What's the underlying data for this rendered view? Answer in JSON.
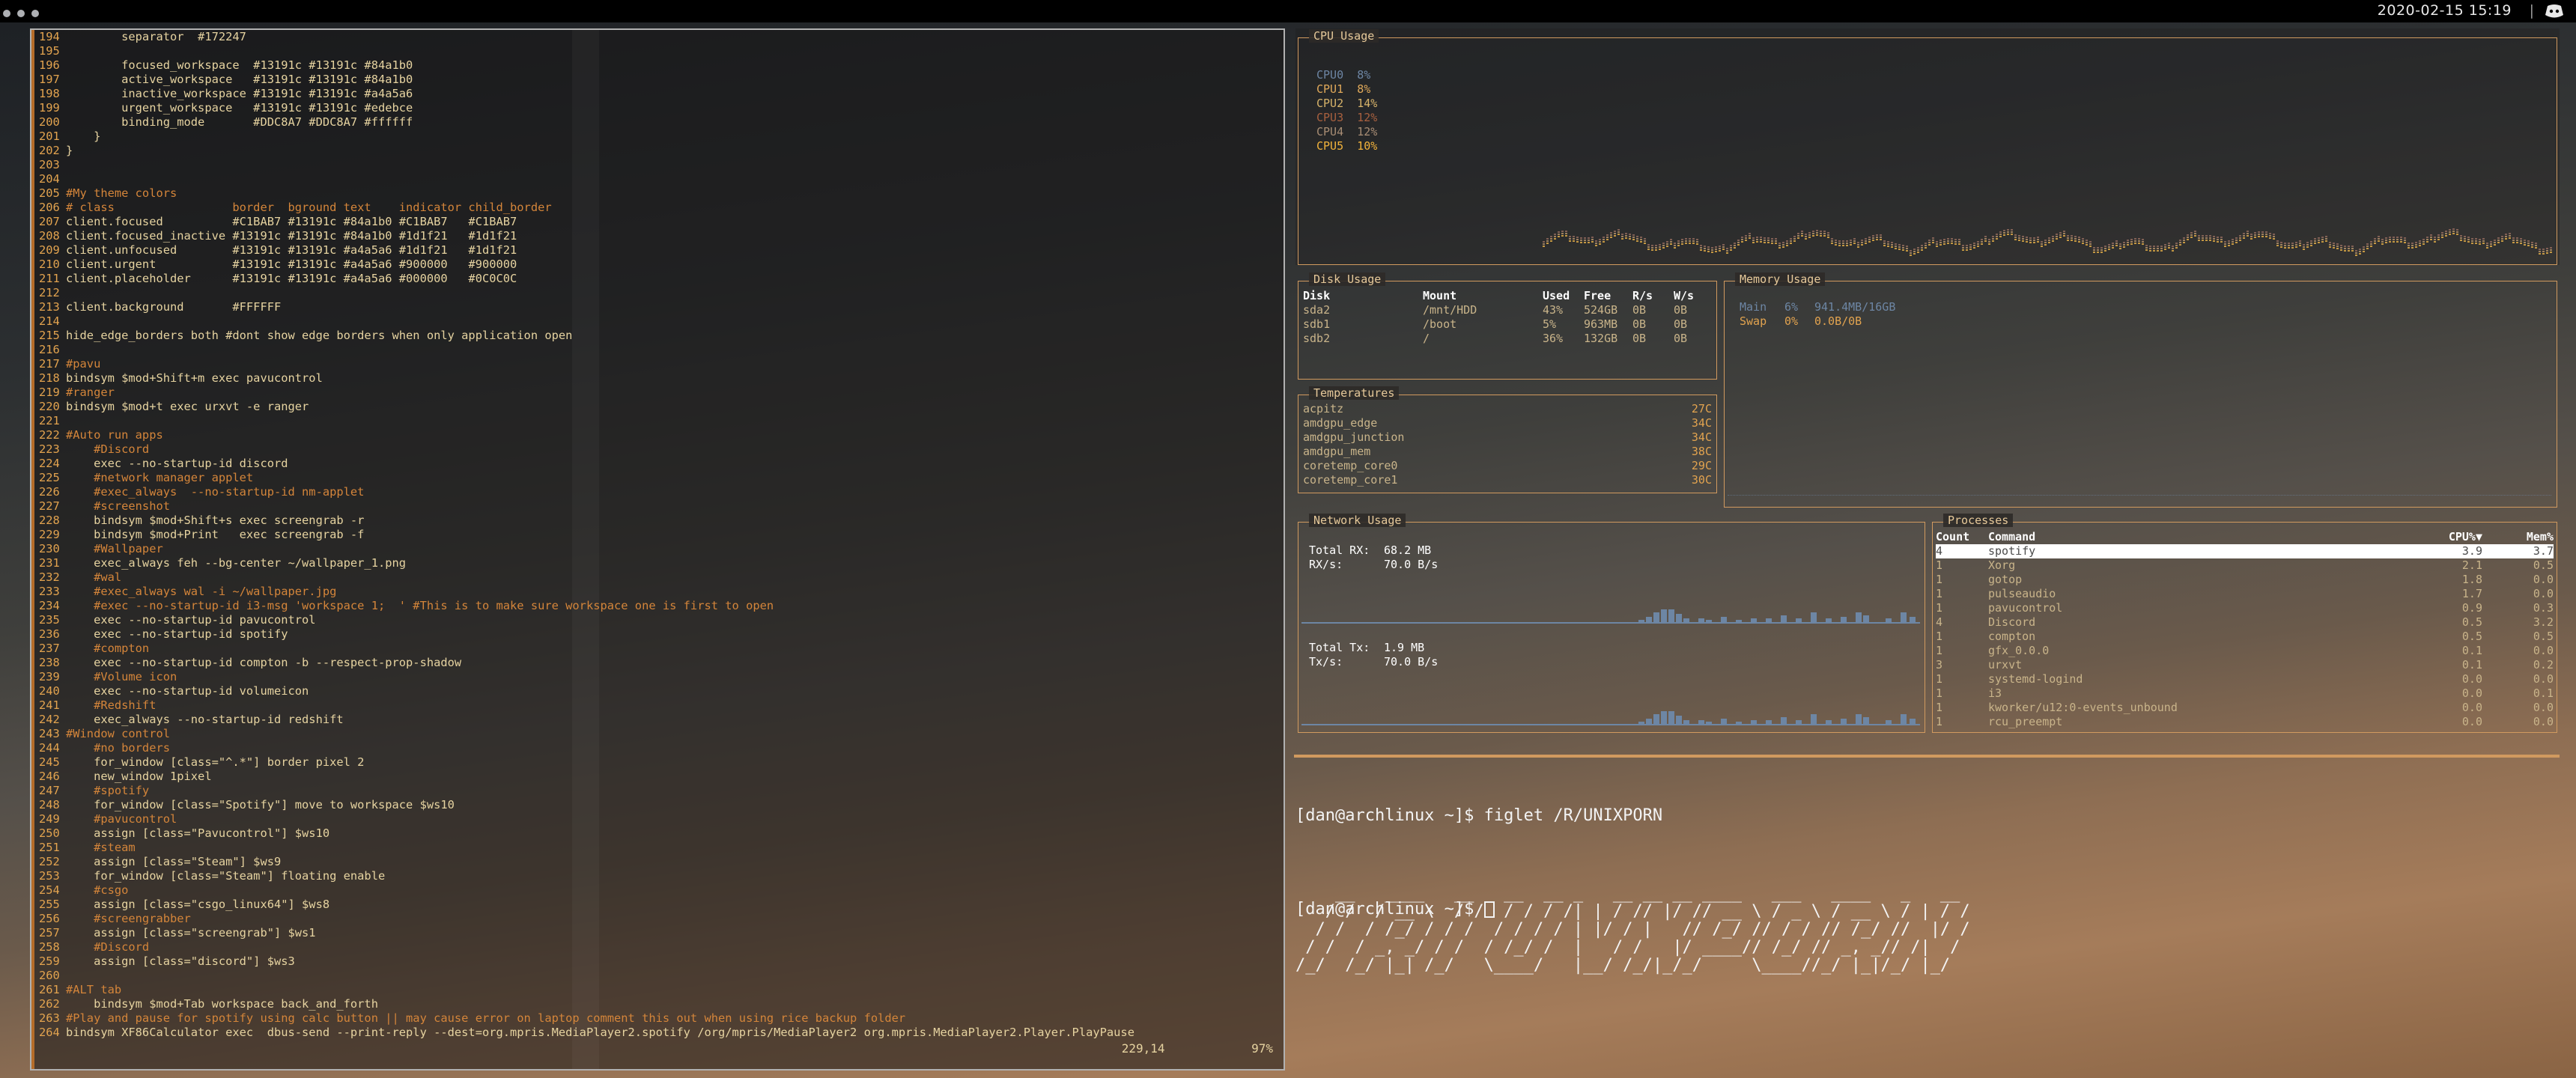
{
  "topbar": {
    "clock": "2020-02-15 15:19"
  },
  "editor": {
    "status_pos": "229,14",
    "status_pct": "97%",
    "lines": [
      {
        "n": "194",
        "text": "        separator  #172247",
        "kind": "t"
      },
      {
        "n": "195",
        "text": "",
        "kind": "t"
      },
      {
        "n": "196",
        "text": "        focused_workspace  #13191c #13191c #84a1b0",
        "kind": "t"
      },
      {
        "n": "197",
        "text": "        active_workspace   #13191c #13191c #84a1b0",
        "kind": "t"
      },
      {
        "n": "198",
        "text": "        inactive_workspace #13191c #13191c #a4a5a6",
        "kind": "t"
      },
      {
        "n": "199",
        "text": "        urgent_workspace   #13191c #13191c #edebce",
        "kind": "t"
      },
      {
        "n": "200",
        "text": "        binding_mode       #DDC8A7 #DDC8A7 #ffffff",
        "kind": "t"
      },
      {
        "n": "201",
        "text": "    }",
        "kind": "t"
      },
      {
        "n": "202",
        "text": "}",
        "kind": "t"
      },
      {
        "n": "203",
        "text": "",
        "kind": "t"
      },
      {
        "n": "204",
        "text": "",
        "kind": "t"
      },
      {
        "n": "205",
        "text": "#My theme colors",
        "kind": "c"
      },
      {
        "n": "206",
        "text": "# class                 border  bground text    indicator child_border",
        "kind": "c"
      },
      {
        "n": "207",
        "text": "client.focused          #C1BAB7 #13191c #84a1b0 #C1BAB7   #C1BAB7",
        "kind": "t"
      },
      {
        "n": "208",
        "text": "client.focused_inactive #13191c #13191c #84a1b0 #1d1f21   #1d1f21",
        "kind": "t"
      },
      {
        "n": "209",
        "text": "client.unfocused        #13191c #13191c #a4a5a6 #1d1f21   #1d1f21",
        "kind": "t"
      },
      {
        "n": "210",
        "text": "client.urgent           #13191c #13191c #a4a5a6 #900000   #900000",
        "kind": "t"
      },
      {
        "n": "211",
        "text": "client.placeholder      #13191c #13191c #a4a5a6 #000000   #0C0C0C",
        "kind": "t"
      },
      {
        "n": "212",
        "text": "",
        "kind": "t"
      },
      {
        "n": "213",
        "text": "client.background       #FFFFFF",
        "kind": "t"
      },
      {
        "n": "214",
        "text": "",
        "kind": "t"
      },
      {
        "n": "215",
        "text": "hide_edge_borders both #dont show edge borders when only application open",
        "kind": "t"
      },
      {
        "n": "216",
        "text": "",
        "kind": "t"
      },
      {
        "n": "217",
        "text": "#pavu",
        "kind": "c"
      },
      {
        "n": "218",
        "text": "bindsym $mod+Shift+m exec pavucontrol",
        "kind": "t"
      },
      {
        "n": "219",
        "text": "#ranger",
        "kind": "c"
      },
      {
        "n": "220",
        "text": "bindsym $mod+t exec urxvt -e ranger",
        "kind": "t"
      },
      {
        "n": "221",
        "text": "",
        "kind": "t"
      },
      {
        "n": "222",
        "text": "#Auto run apps",
        "kind": "c"
      },
      {
        "n": "223",
        "text": "    #Discord",
        "kind": "c"
      },
      {
        "n": "224",
        "text": "    exec --no-startup-id discord",
        "kind": "t"
      },
      {
        "n": "225",
        "text": "    #network manager applet",
        "kind": "c"
      },
      {
        "n": "226",
        "text": "    #exec_always  --no-startup-id nm-applet",
        "kind": "c"
      },
      {
        "n": "227",
        "text": "    #screenshot",
        "kind": "c"
      },
      {
        "n": "228",
        "text": "    bindsym $mod+Shift+s exec screengrab -r",
        "kind": "t"
      },
      {
        "n": "229",
        "text": "    bindsym $mod+Print   exec screengrab -f",
        "kind": "t"
      },
      {
        "n": "230",
        "text": "    #Wallpaper",
        "kind": "c"
      },
      {
        "n": "231",
        "text": "    exec_always feh --bg-center ~/wallpaper_1.png",
        "kind": "t"
      },
      {
        "n": "232",
        "text": "    #wal",
        "kind": "c"
      },
      {
        "n": "233",
        "text": "    #exec_always wal -i ~/wallpaper.jpg",
        "kind": "c"
      },
      {
        "n": "234",
        "text": "    #exec --no-startup-id i3-msg 'workspace 1;  ' #This is to make sure workspace one is first to open",
        "kind": "c"
      },
      {
        "n": "235",
        "text": "    exec --no-startup-id pavucontrol",
        "kind": "t"
      },
      {
        "n": "236",
        "text": "    exec --no-startup-id spotify",
        "kind": "t"
      },
      {
        "n": "237",
        "text": "    #compton",
        "kind": "c"
      },
      {
        "n": "238",
        "text": "    exec --no-startup-id compton -b --respect-prop-shadow",
        "kind": "t"
      },
      {
        "n": "239",
        "text": "    #Volume icon",
        "kind": "c"
      },
      {
        "n": "240",
        "text": "    exec --no-startup-id volumeicon",
        "kind": "t"
      },
      {
        "n": "241",
        "text": "    #Redshift",
        "kind": "c"
      },
      {
        "n": "242",
        "text": "    exec_always --no-startup-id redshift",
        "kind": "t"
      },
      {
        "n": "243",
        "text": "#Window control",
        "kind": "c"
      },
      {
        "n": "244",
        "text": "    #no borders",
        "kind": "c"
      },
      {
        "n": "245",
        "text": "    for_window [class=\"^.*\"] border pixel 2",
        "kind": "t"
      },
      {
        "n": "246",
        "text": "    new_window 1pixel",
        "kind": "t"
      },
      {
        "n": "247",
        "text": "    #spotify",
        "kind": "c"
      },
      {
        "n": "248",
        "text": "    for_window [class=\"Spotify\"] move to workspace $ws10",
        "kind": "t"
      },
      {
        "n": "249",
        "text": "    #pavucontrol",
        "kind": "c"
      },
      {
        "n": "250",
        "text": "    assign [class=\"Pavucontrol\"] $ws10",
        "kind": "t"
      },
      {
        "n": "251",
        "text": "    #steam",
        "kind": "c"
      },
      {
        "n": "252",
        "text": "    assign [class=\"Steam\"] $ws9",
        "kind": "t"
      },
      {
        "n": "253",
        "text": "    for_window [class=\"Steam\"] floating enable",
        "kind": "t"
      },
      {
        "n": "254",
        "text": "    #csgo",
        "kind": "c"
      },
      {
        "n": "255",
        "text": "    assign [class=\"csgo_linux64\"] $ws8",
        "kind": "t"
      },
      {
        "n": "256",
        "text": "    #screengrabber",
        "kind": "c"
      },
      {
        "n": "257",
        "text": "    assign [class=\"screengrab\"] $ws1",
        "kind": "t"
      },
      {
        "n": "258",
        "text": "    #Discord",
        "kind": "c"
      },
      {
        "n": "259",
        "text": "    assign [class=\"discord\"] $ws3",
        "kind": "t"
      },
      {
        "n": "260",
        "text": "",
        "kind": "t"
      },
      {
        "n": "261",
        "text": "#ALT tab",
        "kind": "c"
      },
      {
        "n": "262",
        "text": "    bindsym $mod+Tab workspace back_and_forth",
        "kind": "t"
      },
      {
        "n": "263",
        "text": "#Play and pause for spotify using calc button || may cause error on laptop comment this out when using rice backup folder",
        "kind": "c"
      },
      {
        "n": "264",
        "text": "bindsym XF86Calculator exec  dbus-send --print-reply --dest=org.mpris.MediaPlayer2.spotify /org/mpris/MediaPlayer2 org.mpris.MediaPlayer2.Player.PlayPause",
        "kind": "t"
      }
    ]
  },
  "cpu": {
    "title": "CPU Usage",
    "cores": [
      {
        "name": "CPU0",
        "val": "8%",
        "color": "#6d86a4"
      },
      {
        "name": "CPU1",
        "val": "8%",
        "color": "#e0a95a"
      },
      {
        "name": "CPU2",
        "val": "14%",
        "color": "#d7b36a"
      },
      {
        "name": "CPU3",
        "val": "12%",
        "color": "#a8603f"
      },
      {
        "name": "CPU4",
        "val": "12%",
        "color": "#a88d74"
      },
      {
        "name": "CPU5",
        "val": "10%",
        "color": "#f2b33b"
      }
    ]
  },
  "disk": {
    "title": "Disk Usage",
    "headers": [
      "Disk",
      "Mount",
      "Used",
      "Free",
      "R/s",
      "W/s"
    ],
    "rows": [
      [
        "sda2",
        "/mnt/HDD",
        "43%",
        "524GB",
        "0B",
        "0B"
      ],
      [
        "sdb1",
        "/boot",
        "5%",
        "963MB",
        "0B",
        "0B"
      ],
      [
        "sdb2",
        "/",
        "36%",
        "132GB",
        "0B",
        "0B"
      ]
    ]
  },
  "memory": {
    "title": "Memory Usage",
    "main_label": "Main",
    "main_pct": "6%",
    "main_val": "941.4MB/16GB",
    "swap_label": "Swap",
    "swap_pct": "0%",
    "swap_val": "0.0B/0B"
  },
  "temps": {
    "title": "Temperatures",
    "rows": [
      [
        "acpitz",
        "27C"
      ],
      [
        "amdgpu_edge",
        "34C"
      ],
      [
        "amdgpu_junction",
        "34C"
      ],
      [
        "amdgpu_mem",
        "38C"
      ],
      [
        "coretemp_core0",
        "29C"
      ],
      [
        "coretemp_core1",
        "30C"
      ]
    ]
  },
  "network": {
    "title": "Network Usage",
    "rx_total_label": "Total RX:",
    "rx_total": "68.2 MB",
    "rx_rate_label": "RX/s:",
    "rx_rate": "70.0 B/s",
    "tx_total_label": "Total Tx:",
    "tx_total": "1.9 MB",
    "tx_rate_label": "Tx/s:",
    "tx_rate": "70.0 B/s"
  },
  "processes": {
    "title": "Processes",
    "headers": [
      "Count",
      "Command",
      "CPU%▼",
      "Mem%"
    ],
    "rows": [
      [
        "4",
        "spotify",
        "3.9",
        "3.7"
      ],
      [
        "1",
        "Xorg",
        "2.1",
        "0.5"
      ],
      [
        "1",
        "gotop",
        "1.8",
        "0.0"
      ],
      [
        "1",
        "pulseaudio",
        "1.7",
        "0.0"
      ],
      [
        "1",
        "pavucontrol",
        "0.9",
        "0.3"
      ],
      [
        "4",
        "Discord",
        "0.5",
        "3.2"
      ],
      [
        "1",
        "compton",
        "0.5",
        "0.5"
      ],
      [
        "1",
        "gfx_0.0.0",
        "0.1",
        "0.0"
      ],
      [
        "3",
        "urxvt",
        "0.1",
        "0.2"
      ],
      [
        "1",
        "systemd-logind",
        "0.0",
        "0.0"
      ],
      [
        "1",
        "i3",
        "0.0",
        "0.1"
      ],
      [
        "1",
        "kworker/u12:0-events_unbound",
        "0.0",
        "0.0"
      ],
      [
        "1",
        "rcu_preempt",
        "0.0",
        "0.0"
      ]
    ]
  },
  "shell": {
    "prompt1": "[dan@archlinux ~]$ figlet /R/UNIXPORN",
    "figlet": "    __   ____   __   __  __ _   __ __ __ ____   ___   ____   _   __\n   / /  / __ \\  / /  / / / /| | / // |/ // __ \\ / _ \\ / __ \\ / | / /\n  / /  / /_/ / / /  / / / / | |/ / |   // /_/ // / / // /_/ //  |/ /\n / /  / _, _/ / /  / /_/ /  |   / /   |/ ____// /_/ // _, _// /|  /\n/_/  /_/ |_| /_/   \\____/   |__/ /_/|_/_/     \\____//_/ |_|/_/ |_/",
    "prompt2": "[dan@archlinux ~]$ "
  }
}
